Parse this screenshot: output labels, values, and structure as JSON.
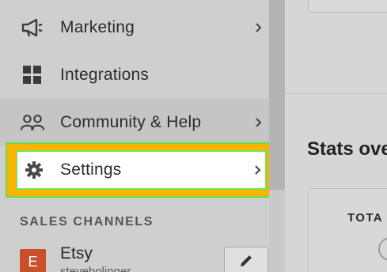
{
  "sidebar": {
    "items": [
      {
        "label": "Marketing",
        "icon": "megaphone-icon",
        "has_chevron": true
      },
      {
        "label": "Integrations",
        "icon": "grid-icon",
        "has_chevron": false
      },
      {
        "label": "Community & Help",
        "icon": "people-icon",
        "has_chevron": true
      },
      {
        "label": "Settings",
        "icon": "gear-icon",
        "has_chevron": true
      }
    ],
    "sales_channels_title": "SALES CHANNELS",
    "channel": {
      "badge": "E",
      "label": "Etsy",
      "sub": "stevebolinger"
    }
  },
  "main": {
    "stats_title": "Stats ove",
    "card_label": "TOTA"
  },
  "colors": {
    "highlight": "#f7b500",
    "highlight_border": "#6bdc4a",
    "etsy": "#c8502b"
  }
}
